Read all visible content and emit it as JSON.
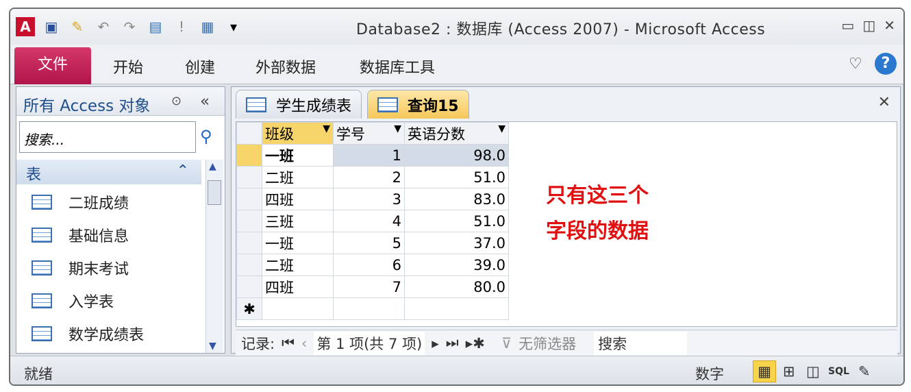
{
  "window": {
    "title": "Database2 : 数据库 (Access 2007)  -  Microsoft Access"
  },
  "ribbon": {
    "tabs": [
      "文件",
      "开始",
      "创建",
      "外部数据",
      "数据库工具"
    ]
  },
  "nav": {
    "title": "所有 Access 对象",
    "search_placeholder": "搜索...",
    "group": "表",
    "items": [
      "二班成绩",
      "基础信息",
      "期末考试",
      "入学表",
      "数学成绩表"
    ]
  },
  "doc_tabs": [
    "学生成绩表",
    "查询15"
  ],
  "grid": {
    "columns": [
      "班级",
      "学号",
      "英语分数"
    ],
    "rows": [
      [
        "一班",
        "1",
        "98.0"
      ],
      [
        "二班",
        "2",
        "51.0"
      ],
      [
        "四班",
        "3",
        "83.0"
      ],
      [
        "三班",
        "4",
        "51.0"
      ],
      [
        "一班",
        "5",
        "37.0"
      ],
      [
        "二班",
        "6",
        "39.0"
      ],
      [
        "四班",
        "7",
        "80.0"
      ]
    ],
    "new_row_marker": "✱"
  },
  "annotation": [
    "只有这三个",
    "字段的数据"
  ],
  "recnav": {
    "label": "记录:",
    "position": "第 1 项(共 7 项)",
    "filter": "无筛选器",
    "search": "搜索"
  },
  "status": {
    "left": "就绪",
    "mode": "数字",
    "sql": "SQL"
  },
  "colors": {
    "file_tab": "#c0245a",
    "active_tab": "#f7c85a",
    "annotation": "#e01010"
  }
}
